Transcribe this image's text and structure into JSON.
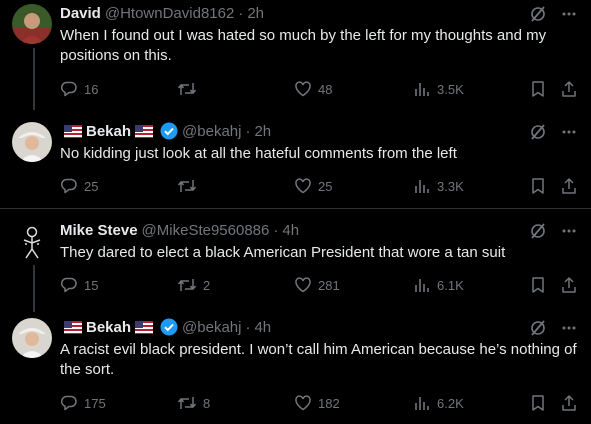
{
  "tweets": [
    {
      "name": "David",
      "handle": "@HtownDavid8162",
      "time": "2h",
      "text": "When I found out I was hated  so much by the left for my thoughts and my positions on this.",
      "replies": "16",
      "retweets": "",
      "likes": "48",
      "views": "3.5K",
      "flags": false,
      "verified": false
    },
    {
      "name": "Bekah",
      "handle": "@bekahj",
      "time": "2h",
      "text": "No kidding just look at all the hateful comments from the left",
      "replies": "25",
      "retweets": "",
      "likes": "25",
      "views": "3.3K",
      "flags": true,
      "verified": true
    },
    {
      "name": "Mike Steve",
      "handle": "@MikeSte9560886",
      "time": "4h",
      "text": "They dared to elect a black American President that wore a tan suit",
      "replies": "15",
      "retweets": "2",
      "likes": "281",
      "views": "6.1K",
      "flags": false,
      "verified": false
    },
    {
      "name": "Bekah",
      "handle": "@bekahj",
      "time": "4h",
      "text": "A racist evil black president. I won’t call him American because he’s nothing of the sort.",
      "replies": "175",
      "retweets": "8",
      "likes": "182",
      "views": "6.2K",
      "flags": true,
      "verified": true
    }
  ],
  "dot": "·",
  "colors": {
    "background": "#000000",
    "text": "#e7e9ea",
    "secondary": "#71767b",
    "verified": "#1d9bf0",
    "divider": "#2f3336"
  },
  "icons": [
    "reply-icon",
    "retweet-icon",
    "like-icon",
    "views-icon",
    "bookmark-icon",
    "share-icon",
    "grok-icon",
    "more-icon",
    "verified-badge-icon",
    "us-flag-icon"
  ]
}
